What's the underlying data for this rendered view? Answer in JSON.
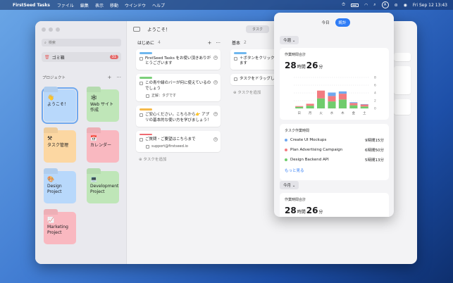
{
  "menubar": {
    "apple": "",
    "app_name": "FirstSeed Tasks",
    "menus": [
      "ファイル",
      "編集",
      "表示",
      "移動",
      "ウインドウ",
      "ヘルプ"
    ],
    "tray_icon": "A",
    "datetime": "Fri Sep 12  13:43"
  },
  "sidebar": {
    "search_placeholder": "検索",
    "trash_label": "ゴミ箱",
    "trash_count": "31",
    "projects_header": "プロジェクト",
    "projects_add": "+",
    "projects_more": "···",
    "folders": [
      {
        "name": "ようこそ！",
        "emoji": "👋",
        "color": "blue"
      },
      {
        "name": "Web サイト作成",
        "emoji": "🕸",
        "color": "green"
      },
      {
        "name": "タスク管理",
        "emoji": "⚒",
        "color": "orange"
      },
      {
        "name": "カレンダー",
        "emoji": "📅",
        "color": "pink"
      },
      {
        "name": "Design Project",
        "emoji": "🎨",
        "color": "blue"
      },
      {
        "name": "Development Project",
        "emoji": "💻",
        "color": "green"
      },
      {
        "name": "Marketing Project",
        "emoji": "📈",
        "color": "pink"
      }
    ]
  },
  "main": {
    "title": "ようこそ！",
    "center_button": "タスク",
    "add_task_label": "タスクを追加",
    "columns": [
      {
        "name": "はじめに",
        "count": "4",
        "cards": [
          {
            "color": "#6fb7ee",
            "text": "FirstSeed Tasks をお使い頂きありがとうございます",
            "sub": ""
          },
          {
            "color": "#7bcf7a",
            "text": "この青や緑のバーが何に使えているのでしょう",
            "sub": "正解：タグです"
          },
          {
            "color": "#f5b94a",
            "text": "ご安心ください。こちらから👉 アプリの基本的な使い方を学びましょう！",
            "sub": ""
          },
          {
            "color": "#ef6b72",
            "text": "ご質問・ご要望はこちらまで",
            "sub": "support@firstseed.io"
          }
        ]
      },
      {
        "name": "基本",
        "count": "2",
        "cards": [
          {
            "color": "#6fb7ee",
            "text": "＋ボタンをクリックしてタスクが作れます",
            "sub": ""
          },
          {
            "color": "",
            "text": "タスクをドラッグして移動できます",
            "sub": ""
          }
        ]
      }
    ]
  },
  "popover": {
    "tabs": [
      "今日",
      "統計"
    ],
    "active_tab": "統計",
    "week_range": "今週",
    "month_range": "今月",
    "total_label": "作業時間合計",
    "total_hours": "28",
    "total_minutes": "26",
    "hour_unit": "時間",
    "minute_unit": "分",
    "task_time_label": "タスク作業時間",
    "tasks": [
      {
        "name": "Create UI Mockups",
        "time": "9時間15分",
        "color": "#6fa8ef"
      },
      {
        "name": "Plan Advertising Campaign",
        "time": "6時間50分",
        "color": "#f27b80"
      },
      {
        "name": "Design Backend API",
        "time": "5時間13分",
        "color": "#6fcc6c"
      }
    ],
    "more_label": "もっと見る",
    "month_total_hours": "28",
    "month_total_minutes": "26"
  },
  "chart_data": {
    "type": "bar",
    "categories": [
      "日",
      "月",
      "火",
      "水",
      "木",
      "金",
      "土"
    ],
    "series": [
      {
        "values": [
          0.4,
          0.7,
          2.6,
          1.8,
          2.3,
          0.8,
          0.5
        ]
      },
      {
        "values": [
          0.2,
          0.5,
          2.0,
          1.4,
          1.5,
          0.6,
          0.5
        ]
      },
      {
        "values": [
          0,
          0,
          0,
          0.9,
          0.6,
          0.2,
          0.1
        ]
      }
    ],
    "colors": [
      "#6fcc6c",
      "#f27b80",
      "#6fa8ef"
    ],
    "ylim": [
      0,
      8
    ],
    "yticks": [
      "8",
      "6",
      "4",
      "2",
      "0"
    ],
    "stacked": true
  }
}
